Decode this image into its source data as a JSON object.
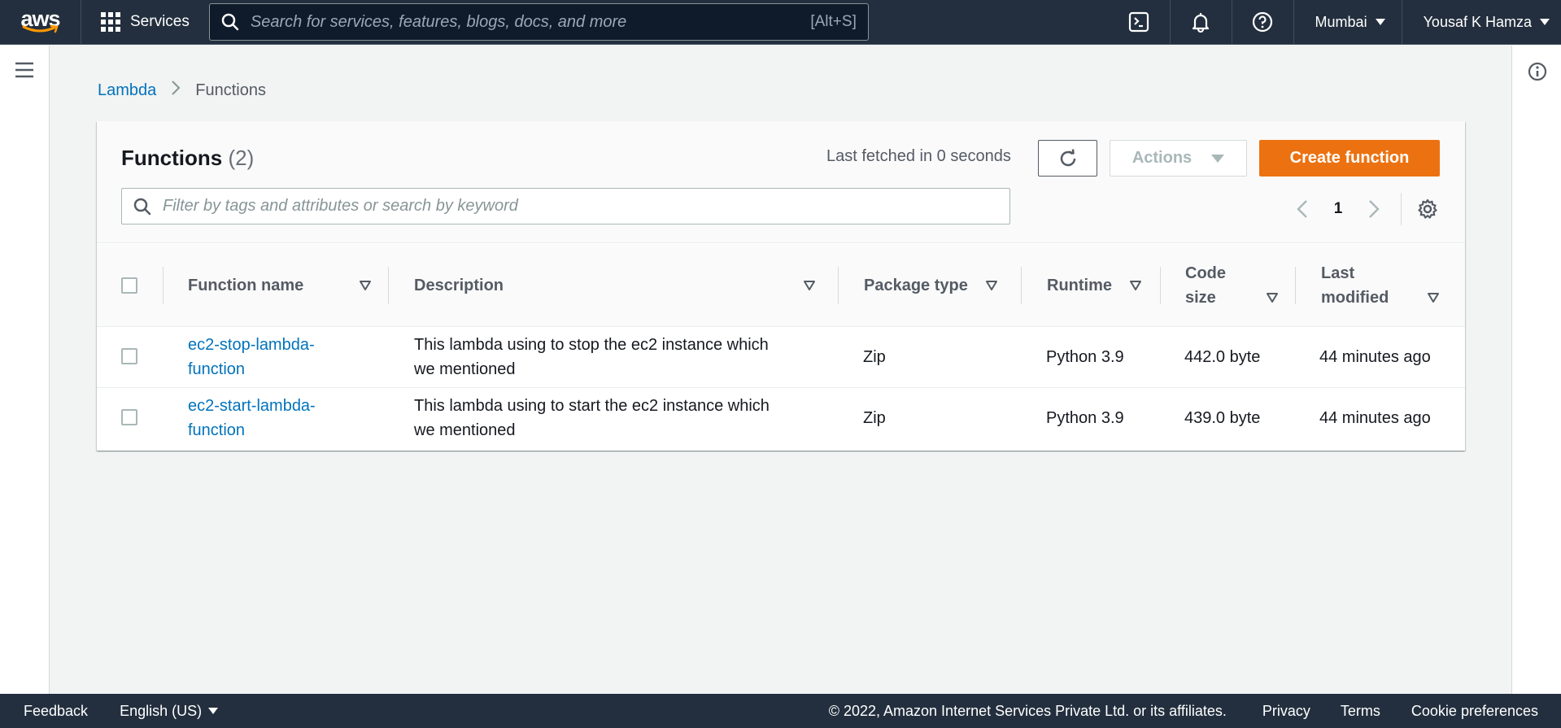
{
  "nav": {
    "logo": "aws",
    "services_label": "Services",
    "search_placeholder": "Search for services, features, blogs, docs, and more",
    "search_shortcut": "[Alt+S]",
    "region": "Mumbai",
    "user": "Yousaf K Hamza",
    "icons": [
      "cloudshell-icon",
      "bell-icon",
      "help-icon"
    ]
  },
  "breadcrumb": {
    "root": "Lambda",
    "current": "Functions"
  },
  "panel": {
    "title": "Functions",
    "count": "(2)",
    "fetched": "Last fetched in 0 seconds",
    "actions_label": "Actions",
    "create_label": "Create function",
    "filter_placeholder": "Filter by tags and attributes or search by keyword",
    "page": "1"
  },
  "table": {
    "headers": {
      "name": "Function name",
      "description": "Description",
      "package": "Package type",
      "runtime": "Runtime",
      "code_size_1": "Code",
      "code_size_2": "size",
      "modified_1": "Last",
      "modified_2": "modified"
    },
    "rows": [
      {
        "name_1": "ec2-stop-lambda-",
        "name_2": "function",
        "desc_1": "This lambda using to stop the ec2 instance which",
        "desc_2": "we mentioned",
        "package": "Zip",
        "runtime": "Python 3.9",
        "code_size": "442.0 byte",
        "modified": "44 minutes ago"
      },
      {
        "name_1": "ec2-start-lambda-",
        "name_2": "function",
        "desc_1": "This lambda using to start the ec2 instance which",
        "desc_2": "we mentioned",
        "package": "Zip",
        "runtime": "Python 3.9",
        "code_size": "439.0 byte",
        "modified": "44 minutes ago"
      }
    ]
  },
  "footer": {
    "feedback": "Feedback",
    "language": "English (US)",
    "copyright": "© 2022, Amazon Internet Services Private Ltd. or its affiliates.",
    "privacy": "Privacy",
    "terms": "Terms",
    "cookie": "Cookie preferences"
  },
  "colors": {
    "nav_bg": "#232f3e",
    "primary_button": "#ec7211",
    "link": "#0073bb"
  }
}
